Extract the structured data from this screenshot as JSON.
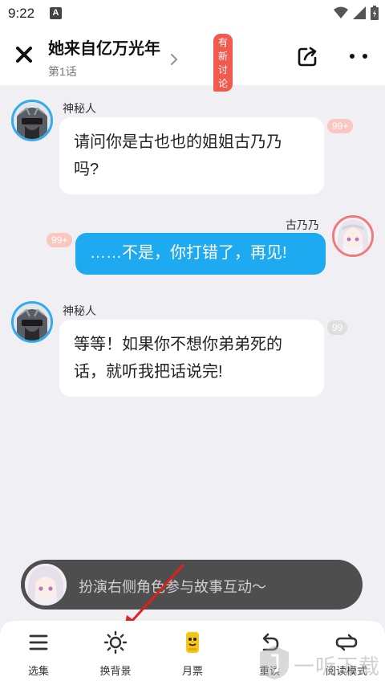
{
  "status_bar": {
    "time": "9:22",
    "notification_letter": "A"
  },
  "header": {
    "title": "她来自亿万光年",
    "subtitle": "第1话",
    "badge": "有新讨论"
  },
  "messages": [
    {
      "speaker": "神秘人",
      "side": "left",
      "text_lines": [
        "请问你是古也也的姐姐古乃乃",
        "吗?"
      ],
      "count": "99+"
    },
    {
      "speaker": "古乃乃",
      "side": "right",
      "text_lines": [
        "……不是，你打错了，再见!"
      ],
      "count": "99+"
    },
    {
      "speaker": "神秘人",
      "side": "left",
      "text_lines": [
        "等等！如果你不想你弟弟死的",
        "话，就听我把话说完!"
      ],
      "count": "99"
    }
  ],
  "prompt": {
    "text": "扮演右侧角色参与故事互动～"
  },
  "bottom_nav": [
    {
      "label": "选集",
      "icon": "menu-icon"
    },
    {
      "label": "换背景",
      "icon": "sun-icon"
    },
    {
      "label": "月票",
      "icon": "ticket-icon"
    },
    {
      "label": "重读",
      "icon": "undo-icon"
    },
    {
      "label": "阅读模式",
      "icon": "loop-icon"
    }
  ],
  "watermark": {
    "text": "一听下载"
  },
  "colors": {
    "accent_blue": "#1eaaf1",
    "badge_red": "#f25a4e",
    "count_pink": "#f9c7bf",
    "background": "#efeff4"
  }
}
